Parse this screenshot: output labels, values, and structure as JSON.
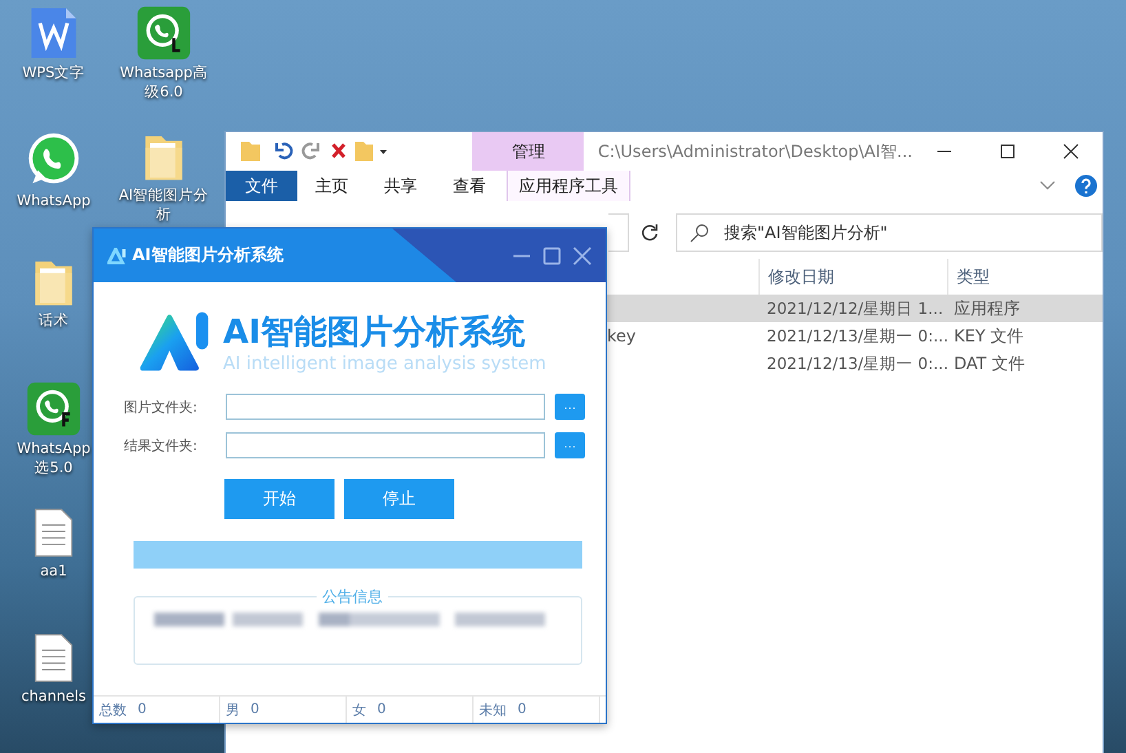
{
  "desktop_icons": [
    {
      "label": "WPS文字",
      "kind": "wps"
    },
    {
      "label": "WhatsApp",
      "kind": "whatsapp"
    },
    {
      "label": "话术",
      "kind": "folder"
    },
    {
      "label": "WhatsApp选5.0",
      "kind": "whatsapp-f"
    },
    {
      "label": "aa1",
      "kind": "document"
    },
    {
      "label": "channels",
      "kind": "document"
    },
    {
      "label": "Whatsapp高级6.0",
      "kind": "whatsapp-l"
    },
    {
      "label": "AI智能图片分析",
      "kind": "folder"
    }
  ],
  "explorer": {
    "context_tab": "管理",
    "path": "C:\\Users\\Administrator\\Desktop\\AI智...",
    "ribbon_tabs": [
      {
        "label": "文件",
        "selected": true
      },
      {
        "label": "主页",
        "selected": false
      },
      {
        "label": "共享",
        "selected": false
      },
      {
        "label": "查看",
        "selected": false
      },
      {
        "label": "应用程序工具",
        "selected": false
      }
    ],
    "search": {
      "placeholder": "搜索\"AI智能图片分析\""
    },
    "columns": [
      "修改日期",
      "类型"
    ],
    "rows": [
      {
        "name": "",
        "date": "2021/12/12/星期日 1...",
        "type": "应用程序",
        "selected": true
      },
      {
        "name": "key",
        "date": "2021/12/13/星期一 0:...",
        "type": "KEY 文件",
        "selected": false
      },
      {
        "name": "",
        "date": "2021/12/13/星期一 0:...",
        "type": "DAT 文件",
        "selected": false
      }
    ]
  },
  "app": {
    "title": "AI智能图片分析系统",
    "brand": "AI智能图片分析系统",
    "subtitle": "AI intelligent image analysis system",
    "fields": [
      {
        "label": "图片文件夹:",
        "browse": "···"
      },
      {
        "label": "结果文件夹:",
        "browse": "···"
      }
    ],
    "buttons": [
      "开始",
      "停止"
    ],
    "progress": {
      "level": 1
    },
    "notice": {
      "title": "公告信息"
    },
    "status_bar": [
      {
        "label": "总数",
        "value": "0"
      },
      {
        "label": "男",
        "value": "0"
      },
      {
        "label": "女",
        "value": "0"
      },
      {
        "label": "未知",
        "value": "0"
      }
    ]
  }
}
